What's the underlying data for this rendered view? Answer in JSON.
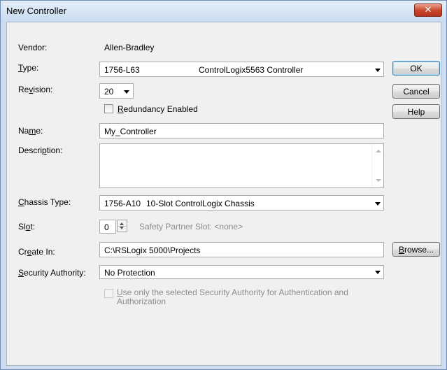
{
  "window": {
    "title": "New Controller",
    "close_glyph": "✕"
  },
  "vendor": {
    "label": "Vendor:",
    "value": "Allen-Bradley"
  },
  "type": {
    "label_pre": "",
    "label_u": "T",
    "label_post": "ype:",
    "code": "1756-L63",
    "description": "ControlLogix5563 Controller"
  },
  "revision": {
    "label_pre": "Re",
    "label_u": "v",
    "label_post": "ision:",
    "value": "20"
  },
  "redundancy": {
    "label_u": "R",
    "label_post": "edundancy Enabled",
    "checked": false
  },
  "name": {
    "label_pre": "Na",
    "label_u": "m",
    "label_post": "e:",
    "value": "My_Controller"
  },
  "description": {
    "label_pre": "Descri",
    "label_u": "p",
    "label_post": "tion:",
    "value": ""
  },
  "chassis": {
    "label_pre": "",
    "label_u": "C",
    "label_post": "hassis Type:",
    "code": "1756-A10",
    "description": "10-Slot ControlLogix Chassis"
  },
  "slot": {
    "label_pre": "Sl",
    "label_u": "o",
    "label_post": "t:",
    "value": "0",
    "safety_partner": "Safety Partner Slot: <none>"
  },
  "create_in": {
    "label_pre": "Cr",
    "label_u": "e",
    "label_post": "ate In:",
    "value": "C:\\RSLogix 5000\\Projects"
  },
  "security": {
    "label_pre": "",
    "label_u": "S",
    "label_post": "ecurity Authority:",
    "value": "No Protection",
    "use_only_u": "U",
    "use_only_line1": "se only the selected Security Authority for Authentication and",
    "use_only_line2": "Authorization",
    "use_only_checked": false
  },
  "buttons": {
    "ok": "OK",
    "cancel": "Cancel",
    "help": "Help",
    "browse_u": "B",
    "browse_post": "rowse..."
  },
  "colors": {
    "close_red": "#c7442a",
    "title_bg": "#c9dcf0",
    "client_bg": "#f0f0f0"
  }
}
